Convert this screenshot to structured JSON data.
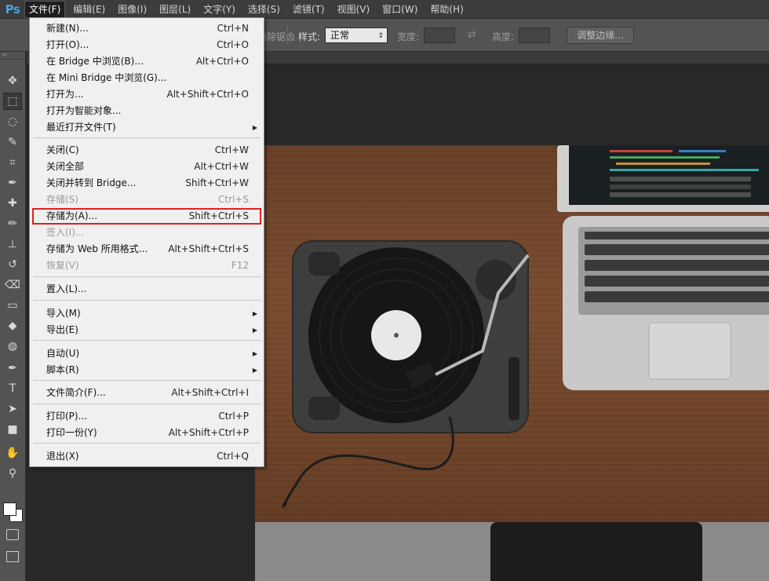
{
  "app": {
    "logo": "Ps"
  },
  "menubar": {
    "items": [
      {
        "label": "文件(F)",
        "active": true
      },
      {
        "label": "编辑(E)"
      },
      {
        "label": "图像(I)"
      },
      {
        "label": "图层(L)"
      },
      {
        "label": "文字(Y)"
      },
      {
        "label": "选择(S)"
      },
      {
        "label": "滤镜(T)"
      },
      {
        "label": "视图(V)"
      },
      {
        "label": "窗口(W)"
      },
      {
        "label": "帮助(H)"
      }
    ]
  },
  "options": {
    "antialias_partial": "消除锯齿",
    "style_label": "样式:",
    "style_value": "正常",
    "width_label": "宽度:",
    "height_label": "高度:",
    "refine_edge": "调整边缘..."
  },
  "file_menu": {
    "items": [
      {
        "label": "新建(N)...",
        "shortcut": "Ctrl+N"
      },
      {
        "label": "打开(O)...",
        "shortcut": "Ctrl+O"
      },
      {
        "label": "在 Bridge 中浏览(B)...",
        "shortcut": "Alt+Ctrl+O"
      },
      {
        "label": "在 Mini Bridge 中浏览(G)...",
        "shortcut": ""
      },
      {
        "label": "打开为...",
        "shortcut": "Alt+Shift+Ctrl+O"
      },
      {
        "label": "打开为智能对象...",
        "shortcut": ""
      },
      {
        "label": "最近打开文件(T)",
        "shortcut": "",
        "submenu": true
      },
      {
        "label": "关闭(C)",
        "shortcut": "Ctrl+W"
      },
      {
        "label": "关闭全部",
        "shortcut": "Alt+Ctrl+W"
      },
      {
        "label": "关闭并转到 Bridge...",
        "shortcut": "Shift+Ctrl+W"
      },
      {
        "label": "存储(S)",
        "shortcut": "Ctrl+S",
        "disabled": true
      },
      {
        "label": "存储为(A)...",
        "shortcut": "Shift+Ctrl+S",
        "highlight": true
      },
      {
        "label": "签入(I)...",
        "shortcut": "",
        "disabled": true
      },
      {
        "label": "存储为 Web 所用格式...",
        "shortcut": "Alt+Shift+Ctrl+S"
      },
      {
        "label": "恢复(V)",
        "shortcut": "F12",
        "disabled": true
      },
      {
        "label": "置入(L)...",
        "shortcut": ""
      },
      {
        "label": "导入(M)",
        "shortcut": "",
        "submenu": true
      },
      {
        "label": "导出(E)",
        "shortcut": "",
        "submenu": true
      },
      {
        "label": "自动(U)",
        "shortcut": "",
        "submenu": true
      },
      {
        "label": "脚本(R)",
        "shortcut": "",
        "submenu": true
      },
      {
        "label": "文件简介(F)...",
        "shortcut": "Alt+Shift+Ctrl+I"
      },
      {
        "label": "打印(P)...",
        "shortcut": "Ctrl+P"
      },
      {
        "label": "打印一份(Y)",
        "shortcut": "Alt+Shift+Ctrl+P"
      },
      {
        "label": "退出(X)",
        "shortcut": "Ctrl+Q"
      }
    ]
  },
  "tools": [
    "move-tool-icon",
    "marquee-tool-icon",
    "lasso-tool-icon",
    "quick-selection-tool-icon",
    "crop-tool-icon",
    "eyedropper-tool-icon",
    "healing-brush-tool-icon",
    "brush-tool-icon",
    "clone-stamp-tool-icon",
    "history-brush-tool-icon",
    "eraser-tool-icon",
    "gradient-tool-icon",
    "blur-tool-icon",
    "dodge-tool-icon",
    "pen-tool-icon",
    "type-tool-icon",
    "path-selection-tool-icon",
    "rectangle-tool-icon",
    "hand-tool-icon",
    "zoom-tool-icon"
  ],
  "colors": {
    "highlight_outline": "#e02020",
    "menubar": "#3c3c3c",
    "panel": "#535353"
  }
}
